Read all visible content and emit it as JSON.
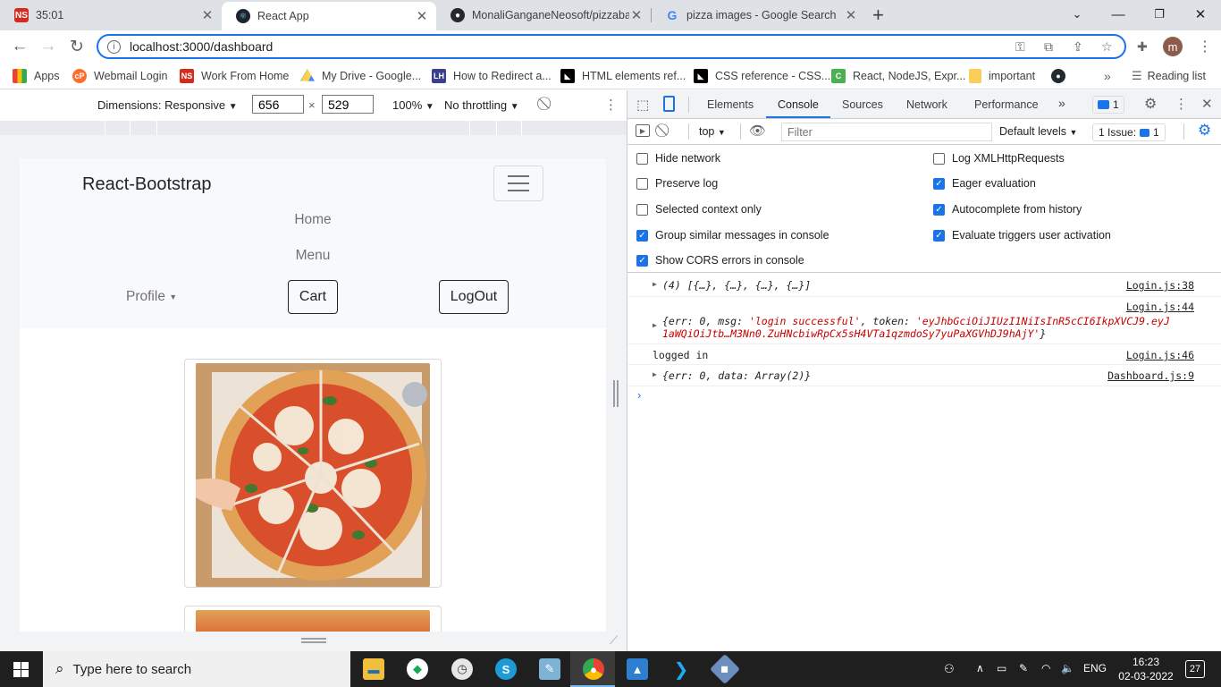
{
  "tabs": [
    {
      "title": "35:01",
      "favicon_text": "NS",
      "favicon_color": "#d52b1e"
    },
    {
      "title": "React App",
      "favicon_text": "⚛",
      "favicon_color": "#20232a"
    },
    {
      "title": "MonaliGanganeNeosoft/pizzaba",
      "favicon_text": "●",
      "favicon_color": "#24292f"
    },
    {
      "title": "pizza images - Google Search",
      "favicon_text": "G",
      "favicon_color": "#ffffff"
    }
  ],
  "address_bar": {
    "url": "localhost:3000/dashboard"
  },
  "profile_initial": "m",
  "bookmarks": [
    {
      "label": "Apps",
      "icon": "apps-grid-icon",
      "color": "#ea4335"
    },
    {
      "label": "Webmail Login",
      "icon": "cpanel-icon",
      "color": "#ff6c2c"
    },
    {
      "label": "Work From Home",
      "icon": "ns-icon",
      "color": "#d52b1e"
    },
    {
      "label": "My Drive - Google...",
      "icon": "drive-icon",
      "color": "#1fa463"
    },
    {
      "label": "How to Redirect a...",
      "icon": "site-icon",
      "color": "#3b3f8f"
    },
    {
      "label": "HTML elements ref...",
      "icon": "mdn-icon",
      "color": "#000000"
    },
    {
      "label": "CSS reference - CSS...",
      "icon": "mdn-icon",
      "color": "#000000"
    },
    {
      "label": "React, NodeJS, Expr...",
      "icon": "site-icon",
      "color": "#4caf50"
    },
    {
      "label": "important",
      "icon": "folder-icon",
      "color": "#f9ce5b"
    },
    {
      "label": "",
      "icon": "github-icon",
      "color": "#24292f"
    },
    {
      "label": "Reading list",
      "icon": "reading-list-icon",
      "color": "#5f6368"
    }
  ],
  "device_toolbar": {
    "dimensions_label": "Dimensions: Responsive",
    "width": "656",
    "height": "529",
    "zoom": "100%",
    "throttle": "No throttling"
  },
  "app": {
    "brand": "React-Bootstrap",
    "nav_home": "Home",
    "nav_menu": "Menu",
    "nav_profile": "Profile",
    "cart_label": "Cart",
    "logout_label": "LogOut"
  },
  "devtools": {
    "tabs": [
      "Elements",
      "Console",
      "Sources",
      "Network",
      "Performance"
    ],
    "active_tab": "Console",
    "message_badge": "1",
    "context": "top",
    "filter_placeholder": "Filter",
    "levels": "Default levels",
    "issues_label": "1 Issue:",
    "issues_count": "1",
    "settings_left": [
      {
        "label": "Hide network",
        "checked": false
      },
      {
        "label": "Preserve log",
        "checked": false
      },
      {
        "label": "Selected context only",
        "checked": false
      },
      {
        "label": "Group similar messages in console",
        "checked": true
      },
      {
        "label": "Show CORS errors in console",
        "checked": true
      }
    ],
    "settings_right": [
      {
        "label": "Log XMLHttpRequests",
        "checked": false
      },
      {
        "label": "Eager evaluation",
        "checked": true
      },
      {
        "label": "Autocomplete from history",
        "checked": true
      },
      {
        "label": "Evaluate triggers user activation",
        "checked": true
      }
    ],
    "logs": [
      {
        "text": "(4) [{…}, {…}, {…}, {…}]",
        "source": "Login.js:38"
      },
      {
        "text_pre": "{err: 0, msg: ",
        "text_str": "'login successful'",
        "text_mid": ", token: ",
        "text_tok": "'eyJhbGciOiJIUzI1NiIsInR5cCI6IkpXVCJ9.eyJ",
        "text_tok2": "1aWQiOiJtb…M3Nn0.ZuHNcbiwRpCx5sH4VTa1qzmdoSy7yuPaXGVhDJ9hAjY'",
        "text_end": "}",
        "source": "Login.js:44"
      },
      {
        "text": "logged in",
        "source": "Login.js:46"
      },
      {
        "text": "{err: 0, data: Array(2)}",
        "source": "Dashboard.js:9"
      }
    ]
  },
  "taskbar": {
    "search_placeholder": "Type here to search",
    "language": "ENG",
    "time": "16:23",
    "date": "02-03-2022",
    "notification_count": "27"
  }
}
